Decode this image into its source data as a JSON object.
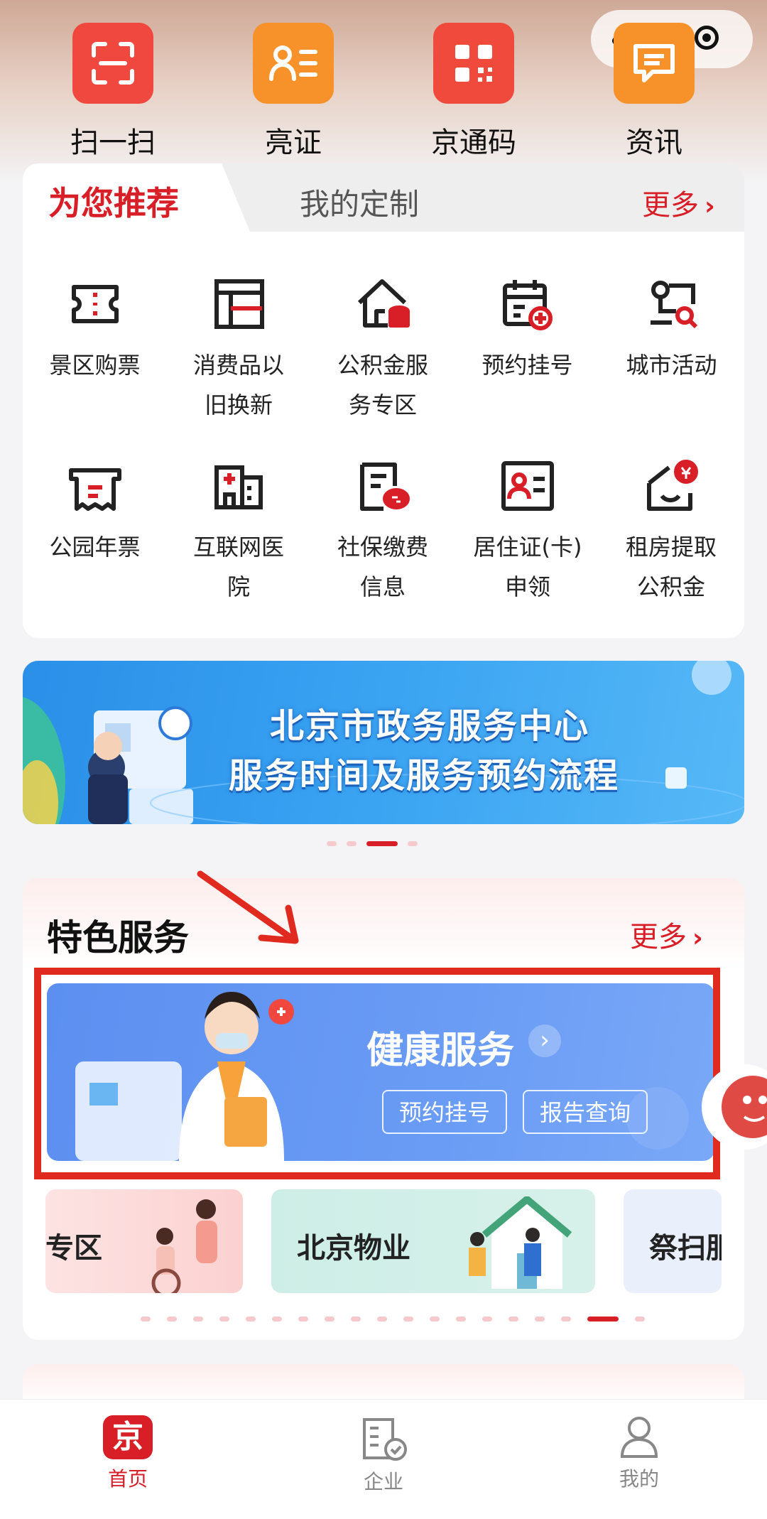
{
  "quick_actions": [
    {
      "label": "扫一扫",
      "icon": "scan-icon",
      "color": "#f0483e"
    },
    {
      "label": "亮证",
      "icon": "id-card-icon",
      "color": "#f7922a"
    },
    {
      "label": "京通码",
      "icon": "qr-code-icon",
      "color": "#ef4a3c"
    },
    {
      "label": "资讯",
      "icon": "news-icon",
      "color": "#f7922a"
    }
  ],
  "recommend": {
    "tab_active": "为您推荐",
    "tab_other": "我的定制",
    "more": "更多",
    "services": [
      {
        "label": "景区购票",
        "icon": "ticket-icon"
      },
      {
        "label": "消费品以旧换新",
        "icon": "trade-in-icon"
      },
      {
        "label": "公积金服务专区",
        "icon": "housing-fund-icon"
      },
      {
        "label": "预约挂号",
        "icon": "calendar-plus-icon"
      },
      {
        "label": "城市活动",
        "icon": "city-activity-icon"
      },
      {
        "label": "公园年票",
        "icon": "park-ticket-icon"
      },
      {
        "label": "互联网医院",
        "icon": "hospital-icon"
      },
      {
        "label": "社保缴费信息",
        "icon": "social-security-icon"
      },
      {
        "label": "居住证(卡)申领",
        "icon": "residence-card-icon"
      },
      {
        "label": "租房提取公积金",
        "icon": "rent-fund-icon"
      }
    ]
  },
  "banner": {
    "line1": "北京市政务服务中心",
    "line2": "服务时间及服务预约流程"
  },
  "banner_dots": {
    "count": 4,
    "active": 2
  },
  "featured": {
    "title": "特色服务",
    "more": "更多",
    "health": {
      "title": "健康服务",
      "btn1": "预约挂号",
      "btn2": "报告查询"
    },
    "mini_cards": [
      {
        "label": "专区"
      },
      {
        "label": "北京物业"
      },
      {
        "label": "祭扫服务"
      }
    ]
  },
  "featured_dots": {
    "count": 19,
    "active": 17
  },
  "tabbar": [
    {
      "label": "首页",
      "icon": "home-jing-icon",
      "active": true
    },
    {
      "label": "企业",
      "icon": "enterprise-icon",
      "active": false
    },
    {
      "label": "我的",
      "icon": "profile-icon",
      "active": false
    }
  ],
  "colors": {
    "accent": "#d81e27",
    "tab_inactive": "#888888"
  }
}
